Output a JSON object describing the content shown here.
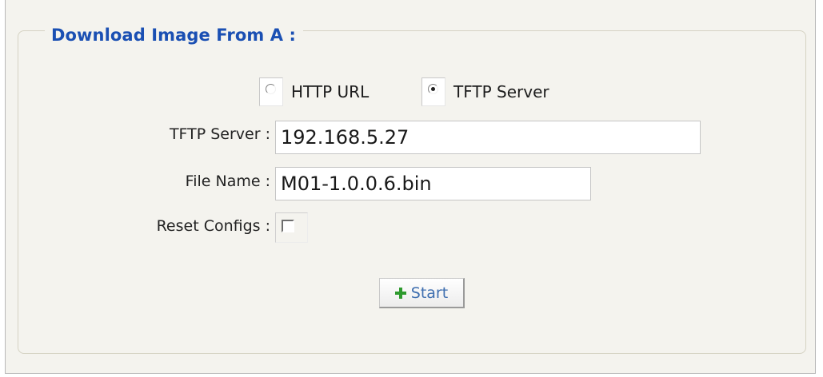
{
  "section": {
    "title": "Download Image From A :"
  },
  "source": {
    "options": [
      {
        "label": "HTTP URL",
        "selected": false
      },
      {
        "label": "TFTP Server",
        "selected": true
      }
    ]
  },
  "form": {
    "tftp_server_label": "TFTP Server :",
    "tftp_server_value": "192.168.5.27",
    "file_name_label": "File Name :",
    "file_name_value": "M01-1.0.0.6.bin",
    "reset_configs_label": "Reset Configs :",
    "reset_configs_checked": false
  },
  "actions": {
    "start_label": "Start",
    "start_icon": "plus-icon"
  },
  "colors": {
    "section_title": "#1a4fb3",
    "panel_bg": "#f4f3ee",
    "start_text": "#3f6fb0",
    "plus_icon": "#2e9a2e"
  }
}
